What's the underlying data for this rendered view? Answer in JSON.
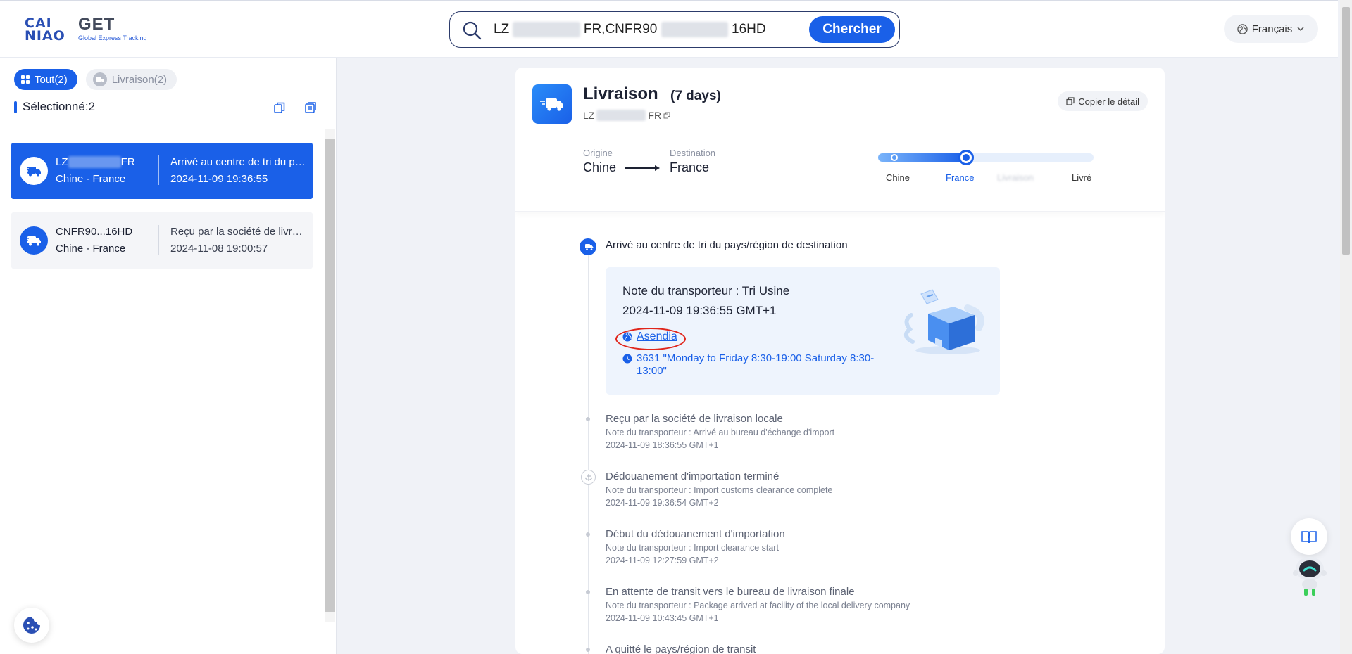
{
  "header": {
    "logo_mark_line1": "CAI",
    "logo_mark_line2": "NIAO",
    "logo_title": "GET",
    "logo_subtitle": "Global Express Tracking",
    "search_value_prefix1": "LZ",
    "search_value_hidden1": "035759937",
    "search_value_mid": "FR,CNFR90",
    "search_value_hidden2": "162093320",
    "search_value_suffix": "16HD",
    "search_button": "Chercher",
    "language": "Français"
  },
  "sidebar": {
    "filters": [
      {
        "label": "Tout(2)",
        "active": true
      },
      {
        "label": "Livraison(2)",
        "active": false
      }
    ],
    "selected_label": "Sélectionné:2",
    "cards": [
      {
        "number_prefix": "LZ",
        "number_hidden": "035759937",
        "number_suffix": "FR",
        "route": "Chine - France",
        "status": "Arrivé au centre de tri du pays/région de destination",
        "datetime": "2024-11-09 19:36:55",
        "selected": true
      },
      {
        "number": "CNFR90...16HD",
        "route": "Chine - France",
        "status": "Reçu par la société de livraison locale",
        "datetime": "2024-11-08 19:00:57",
        "selected": false
      }
    ]
  },
  "detail": {
    "title": "Livraison",
    "days": "(7 days)",
    "tracking_prefix": "LZ",
    "tracking_hidden": "035759937",
    "tracking_suffix": "FR",
    "copy_button": "Copier le détail",
    "origin_label": "Origine",
    "origin_value": "Chine",
    "destination_label": "Destination",
    "destination_value": "France",
    "progress_fraction": 0.41,
    "progress_steps": [
      "Chine",
      "France",
      "Livraison",
      "Livré"
    ],
    "progress_current_step": 1
  },
  "timeline": {
    "current": {
      "title": "Arrivé au centre de tri du pays/région de destination",
      "note": "Note du transporteur : Tri Usine",
      "datetime": "2024-11-09 19:36:55 GMT+1",
      "carrier_link": "Asendia",
      "phone_info": "3631 \"Monday to Friday 8:30-19:00 Saturday 8:30-13:00\""
    },
    "events": [
      {
        "title": "Reçu par la société de livraison locale",
        "note": "Note du transporteur : Arrivé au bureau d'échange d'import",
        "datetime": "2024-11-09 18:36:55 GMT+1"
      },
      {
        "title": "Dédouanement d'importation terminé",
        "note": "Note du transporteur : Import customs clearance complete",
        "datetime": "2024-11-09 19:36:54 GMT+2"
      },
      {
        "title": "Début du dédouanement d'importation",
        "note": "Note du transporteur : Import clearance start",
        "datetime": "2024-11-09 12:27:59 GMT+2"
      },
      {
        "title": "En attente de transit vers le bureau de livraison finale",
        "note": "Note du transporteur : Package arrived at facility of the local delivery company",
        "datetime": "2024-11-09 10:43:45 GMT+1"
      },
      {
        "title": "A quitté le pays/région de transit",
        "note": "",
        "datetime": ""
      }
    ]
  },
  "colors": {
    "accent": "#1a60e8",
    "annotation_circle": "#e0251b"
  }
}
